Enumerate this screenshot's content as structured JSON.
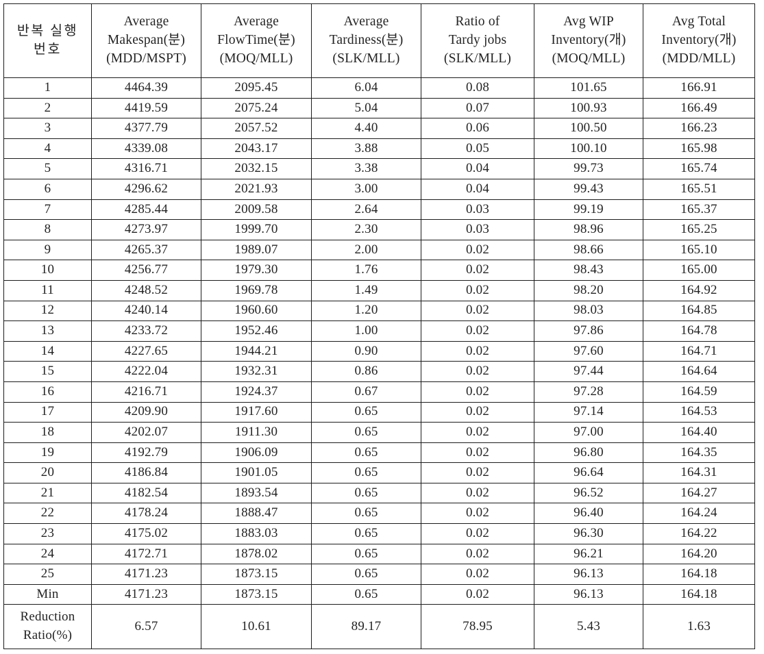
{
  "table": {
    "columns": [
      {
        "key": "index",
        "header_lines": [
          "반복 실행",
          "번호"
        ]
      },
      {
        "key": "makespan",
        "header_lines": [
          "Average",
          "Makespan(분)",
          "(MDD/MSPT)"
        ]
      },
      {
        "key": "flowtime",
        "header_lines": [
          "Average",
          "FlowTime(분)",
          "(MOQ/MLL)"
        ]
      },
      {
        "key": "tardiness",
        "header_lines": [
          "Average",
          "Tardiness(분)",
          "(SLK/MLL)"
        ]
      },
      {
        "key": "tardy_ratio",
        "header_lines": [
          "Ratio of",
          "Tardy jobs",
          "(SLK/MLL)"
        ]
      },
      {
        "key": "wip",
        "header_lines": [
          "Avg WIP",
          "Inventory(개)",
          "(MOQ/MLL)"
        ]
      },
      {
        "key": "total_inv",
        "header_lines": [
          "Avg Total",
          "Inventory(개)",
          "(MDD/MLL)"
        ]
      }
    ],
    "rows": [
      {
        "index": "1",
        "makespan": "4464.39",
        "flowtime": "2095.45",
        "tardiness": "6.04",
        "tardy_ratio": "0.08",
        "wip": "101.65",
        "total_inv": "166.91"
      },
      {
        "index": "2",
        "makespan": "4419.59",
        "flowtime": "2075.24",
        "tardiness": "5.04",
        "tardy_ratio": "0.07",
        "wip": "100.93",
        "total_inv": "166.49"
      },
      {
        "index": "3",
        "makespan": "4377.79",
        "flowtime": "2057.52",
        "tardiness": "4.40",
        "tardy_ratio": "0.06",
        "wip": "100.50",
        "total_inv": "166.23"
      },
      {
        "index": "4",
        "makespan": "4339.08",
        "flowtime": "2043.17",
        "tardiness": "3.88",
        "tardy_ratio": "0.05",
        "wip": "100.10",
        "total_inv": "165.98"
      },
      {
        "index": "5",
        "makespan": "4316.71",
        "flowtime": "2032.15",
        "tardiness": "3.38",
        "tardy_ratio": "0.04",
        "wip": "99.73",
        "total_inv": "165.74"
      },
      {
        "index": "6",
        "makespan": "4296.62",
        "flowtime": "2021.93",
        "tardiness": "3.00",
        "tardy_ratio": "0.04",
        "wip": "99.43",
        "total_inv": "165.51"
      },
      {
        "index": "7",
        "makespan": "4285.44",
        "flowtime": "2009.58",
        "tardiness": "2.64",
        "tardy_ratio": "0.03",
        "wip": "99.19",
        "total_inv": "165.37"
      },
      {
        "index": "8",
        "makespan": "4273.97",
        "flowtime": "1999.70",
        "tardiness": "2.30",
        "tardy_ratio": "0.03",
        "wip": "98.96",
        "total_inv": "165.25"
      },
      {
        "index": "9",
        "makespan": "4265.37",
        "flowtime": "1989.07",
        "tardiness": "2.00",
        "tardy_ratio": "0.02",
        "wip": "98.66",
        "total_inv": "165.10"
      },
      {
        "index": "10",
        "makespan": "4256.77",
        "flowtime": "1979.30",
        "tardiness": "1.76",
        "tardy_ratio": "0.02",
        "wip": "98.43",
        "total_inv": "165.00"
      },
      {
        "index": "11",
        "makespan": "4248.52",
        "flowtime": "1969.78",
        "tardiness": "1.49",
        "tardy_ratio": "0.02",
        "wip": "98.20",
        "total_inv": "164.92"
      },
      {
        "index": "12",
        "makespan": "4240.14",
        "flowtime": "1960.60",
        "tardiness": "1.20",
        "tardy_ratio": "0.02",
        "wip": "98.03",
        "total_inv": "164.85"
      },
      {
        "index": "13",
        "makespan": "4233.72",
        "flowtime": "1952.46",
        "tardiness": "1.00",
        "tardy_ratio": "0.02",
        "wip": "97.86",
        "total_inv": "164.78"
      },
      {
        "index": "14",
        "makespan": "4227.65",
        "flowtime": "1944.21",
        "tardiness": "0.90",
        "tardy_ratio": "0.02",
        "wip": "97.60",
        "total_inv": "164.71"
      },
      {
        "index": "15",
        "makespan": "4222.04",
        "flowtime": "1932.31",
        "tardiness": "0.86",
        "tardy_ratio": "0.02",
        "wip": "97.44",
        "total_inv": "164.64"
      },
      {
        "index": "16",
        "makespan": "4216.71",
        "flowtime": "1924.37",
        "tardiness": "0.67",
        "tardy_ratio": "0.02",
        "wip": "97.28",
        "total_inv": "164.59"
      },
      {
        "index": "17",
        "makespan": "4209.90",
        "flowtime": "1917.60",
        "tardiness": "0.65",
        "tardy_ratio": "0.02",
        "wip": "97.14",
        "total_inv": "164.53"
      },
      {
        "index": "18",
        "makespan": "4202.07",
        "flowtime": "1911.30",
        "tardiness": "0.65",
        "tardy_ratio": "0.02",
        "wip": "97.00",
        "total_inv": "164.40"
      },
      {
        "index": "19",
        "makespan": "4192.79",
        "flowtime": "1906.09",
        "tardiness": "0.65",
        "tardy_ratio": "0.02",
        "wip": "96.80",
        "total_inv": "164.35"
      },
      {
        "index": "20",
        "makespan": "4186.84",
        "flowtime": "1901.05",
        "tardiness": "0.65",
        "tardy_ratio": "0.02",
        "wip": "96.64",
        "total_inv": "164.31"
      },
      {
        "index": "21",
        "makespan": "4182.54",
        "flowtime": "1893.54",
        "tardiness": "0.65",
        "tardy_ratio": "0.02",
        "wip": "96.52",
        "total_inv": "164.27"
      },
      {
        "index": "22",
        "makespan": "4178.24",
        "flowtime": "1888.47",
        "tardiness": "0.65",
        "tardy_ratio": "0.02",
        "wip": "96.40",
        "total_inv": "164.24"
      },
      {
        "index": "23",
        "makespan": "4175.02",
        "flowtime": "1883.03",
        "tardiness": "0.65",
        "tardy_ratio": "0.02",
        "wip": "96.30",
        "total_inv": "164.22"
      },
      {
        "index": "24",
        "makespan": "4172.71",
        "flowtime": "1878.02",
        "tardiness": "0.65",
        "tardy_ratio": "0.02",
        "wip": "96.21",
        "total_inv": "164.20"
      },
      {
        "index": "25",
        "makespan": "4171.23",
        "flowtime": "1873.15",
        "tardiness": "0.65",
        "tardy_ratio": "0.02",
        "wip": "96.13",
        "total_inv": "164.18"
      }
    ],
    "summary_min": {
      "label": "Min",
      "makespan": "4171.23",
      "flowtime": "1873.15",
      "tardiness": "0.65",
      "tardy_ratio": "0.02",
      "wip": "96.13",
      "total_inv": "164.18"
    },
    "summary_reduction": {
      "label_lines": [
        "Reduction",
        "Ratio(%)"
      ],
      "makespan": "6.57",
      "flowtime": "10.61",
      "tardiness": "89.17",
      "tardy_ratio": "78.95",
      "wip": "5.43",
      "total_inv": "1.63"
    }
  },
  "style": {
    "border_color": "#1c1c1c",
    "text_color": "#242424",
    "background": "#ffffff"
  }
}
